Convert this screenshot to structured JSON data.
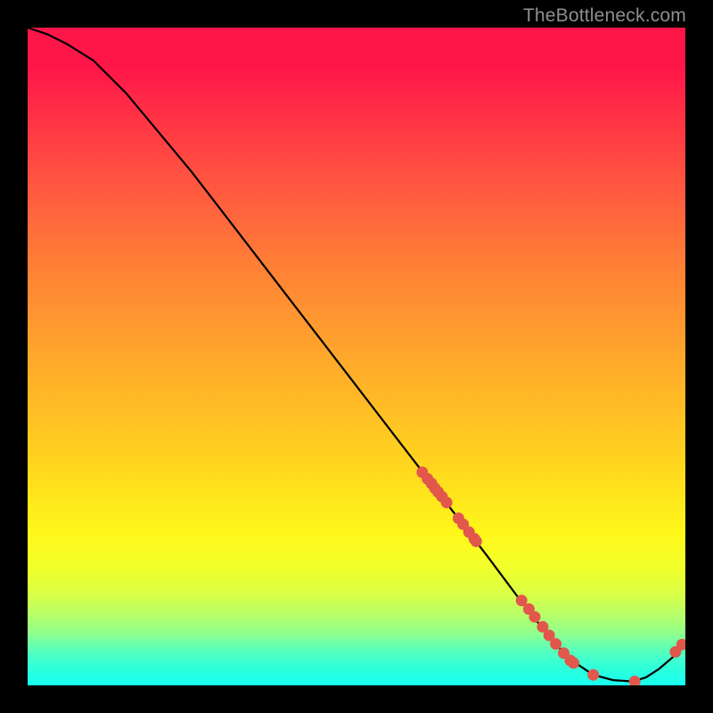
{
  "watermark": "TheBottleneck.com",
  "chart_data": {
    "type": "line",
    "title": "",
    "xlabel": "",
    "ylabel": "",
    "xlim": [
      0,
      100
    ],
    "ylim": [
      0,
      100
    ],
    "grid": false,
    "series": [
      {
        "name": "curve",
        "x": [
          0,
          3,
          6,
          10,
          15,
          20,
          25,
          30,
          35,
          40,
          45,
          50,
          55,
          60,
          65,
          70,
          75,
          80,
          83,
          86,
          89,
          92,
          94,
          96,
          98,
          100
        ],
        "y": [
          100,
          99,
          97.5,
          95,
          90,
          84,
          78,
          71.5,
          65,
          58.5,
          52,
          45.5,
          39,
          32.5,
          26,
          19.5,
          12.8,
          6.5,
          3.6,
          1.6,
          0.8,
          0.6,
          1.2,
          2.5,
          4.2,
          6.5
        ]
      }
    ],
    "points": {
      "name": "dots",
      "x": [
        60,
        60.8,
        61.4,
        61.9,
        62.4,
        63.0,
        63.7,
        65.5,
        66.2,
        67.1,
        67.9,
        68.2,
        75.1,
        76.2,
        77.1,
        78.3,
        79.3,
        80.3,
        81.5,
        82.5,
        83.0,
        86.0,
        92.3,
        98.5,
        99.5
      ],
      "y": [
        32.4,
        31.4,
        30.7,
        30.0,
        29.4,
        28.7,
        27.8,
        25.4,
        24.5,
        23.3,
        22.3,
        21.9,
        12.9,
        11.6,
        10.4,
        8.9,
        7.6,
        6.3,
        4.9,
        3.8,
        3.4,
        1.6,
        0.6,
        5.1,
        6.2
      ]
    },
    "gradient_stops": [
      {
        "pos": 0,
        "color": "#ff1649"
      },
      {
        "pos": 13,
        "color": "#ff3045"
      },
      {
        "pos": 24,
        "color": "#ff5740"
      },
      {
        "pos": 37,
        "color": "#ff8235"
      },
      {
        "pos": 52,
        "color": "#ffad2a"
      },
      {
        "pos": 66,
        "color": "#ffd41e"
      },
      {
        "pos": 77,
        "color": "#fff81a"
      },
      {
        "pos": 86,
        "color": "#daff44"
      },
      {
        "pos": 92,
        "color": "#92ff8c"
      },
      {
        "pos": 96,
        "color": "#41ffcd"
      },
      {
        "pos": 100,
        "color": "#18ffef"
      }
    ]
  }
}
